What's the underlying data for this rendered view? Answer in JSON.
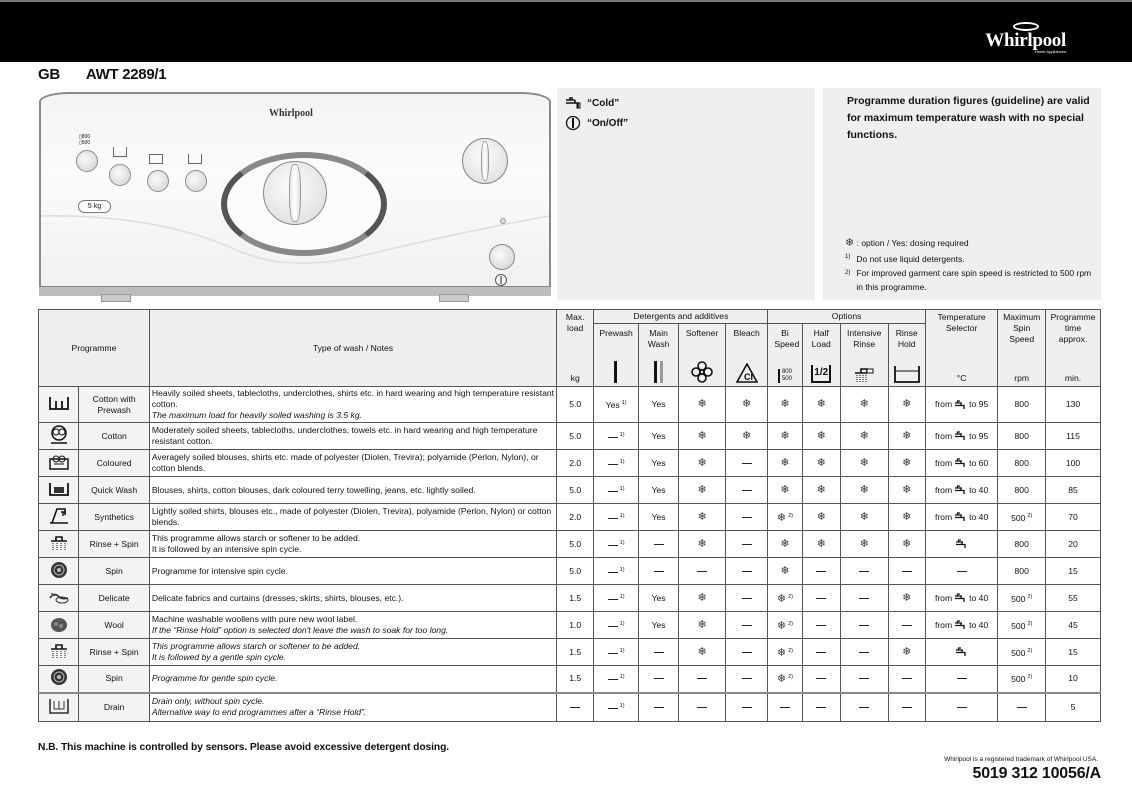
{
  "header": {
    "brand": "Whirlpool",
    "brand_sub": "Home Appliances",
    "country": "GB",
    "model": "AWT 2289/1"
  },
  "panel": {
    "brand": "Whirlpool",
    "load_badge": "5 kg"
  },
  "legend": {
    "cold_label": "“Cold”",
    "cold_icon": "cold-tap-icon",
    "onoff_label": "“On/Off”",
    "onoff_icon": "power-icon"
  },
  "info": {
    "lead": "Programme duration figures (guideline) are valid for maximum temperature wash with no special functions.",
    "option_note": ": option /  Yes: dosing required",
    "footnote1_mark": "1)",
    "footnote1": "Do not use liquid detergents.",
    "footnote2_mark": "2)",
    "footnote2": "For improved garment care spin speed is restricted to 500 rpm in this programme."
  },
  "table": {
    "headers": {
      "programme": "Programme",
      "type_of_wash": "Type of wash / Notes",
      "max_load": "Max. load",
      "max_load_unit": "kg",
      "detergents_group": "Detergents and additives",
      "prewash": "Prewash",
      "main_wash": "Main Wash",
      "softener": "Softener",
      "bleach": "Bleach",
      "options_group": "Options",
      "bi_speed": "Bi Speed",
      "bi_speed_icon_text_1": "800",
      "bi_speed_icon_text_2": "500",
      "half_load": "Half Load",
      "half_load_icon_text": "1/2",
      "intensive_rinse": "Intensive Rinse",
      "rinse_hold": "Rinse Hold",
      "temperature": "Temperature Selector",
      "temperature_unit": "°C",
      "spin": "Maximum Spin Speed",
      "spin_unit": "rpm",
      "time": "Programme time approx.",
      "time_unit": "min."
    },
    "rows": [
      {
        "icon": "cotton-prewash-icon",
        "name": "Cotton with Prewash",
        "desc": "Heavily soiled sheets, tablecloths, underclothes, shirts etc. in hard wearing and high temperature resistant cotton.",
        "note": "The maximum load for heavily soiled washing is 3.5 kg.",
        "load": "5.0",
        "prewash": "Yes",
        "prewash_fn": "1)",
        "main": "Yes",
        "softener": "option",
        "bleach": "option",
        "bispeed": "option",
        "bispeed_fn": "",
        "half": "option",
        "intensive": "option",
        "hold": "option",
        "temp_from": "from",
        "temp_to": "to 95",
        "temp_type": "range",
        "spin": "800",
        "spin_fn": "",
        "time": "130"
      },
      {
        "icon": "cotton-icon",
        "name": "Cotton",
        "desc": "Moderately soiled sheets, tablecloths, underclothes, towels etc. in hard wearing and high temperature resistant cotton.",
        "note": "",
        "load": "5.0",
        "prewash": "none",
        "prewash_fn": "1)",
        "main": "Yes",
        "softener": "option",
        "bleach": "option",
        "bispeed": "option",
        "bispeed_fn": "",
        "half": "option",
        "intensive": "option",
        "hold": "option",
        "temp_from": "from",
        "temp_to": "to 95",
        "temp_type": "range",
        "spin": "800",
        "spin_fn": "",
        "time": "115"
      },
      {
        "icon": "coloured-icon",
        "name": "Coloured",
        "desc": "Averagely soiled blouses, shirts etc. made of polyester (Diolen, Trevira); polyamide (Perlon, Nylon), or cotton blends.",
        "note": "",
        "load": "2.0",
        "prewash": "none",
        "prewash_fn": "1)",
        "main": "Yes",
        "softener": "option",
        "bleach": "none",
        "bispeed": "option",
        "bispeed_fn": "",
        "half": "option",
        "intensive": "option",
        "hold": "option",
        "temp_from": "from",
        "temp_to": "to 60",
        "temp_type": "range",
        "spin": "800",
        "spin_fn": "",
        "time": "100"
      },
      {
        "icon": "quick-wash-icon",
        "name": "Quick Wash",
        "desc": "Blouses, shirts, cotton blouses, dark coloured terry towelling, jeans, etc. lightly soiled.",
        "note": "",
        "load": "5.0",
        "prewash": "none",
        "prewash_fn": "1)",
        "main": "Yes",
        "softener": "option",
        "bleach": "none",
        "bispeed": "option",
        "bispeed_fn": "",
        "half": "option",
        "intensive": "option",
        "hold": "option",
        "temp_from": "from",
        "temp_to": "to 40",
        "temp_type": "range",
        "spin": "800",
        "spin_fn": "",
        "time": "85"
      },
      {
        "icon": "synthetics-icon",
        "name": "Synthetics",
        "desc": "Lightly soiled shirts, blouses etc., made of polyester (Diolen, Trevira), polyamide (Perlon, Nylon) or cotton blends.",
        "note": "",
        "load": "2.0",
        "prewash": "none",
        "prewash_fn": "1)",
        "main": "Yes",
        "softener": "option",
        "bleach": "none",
        "bispeed": "option",
        "bispeed_fn": "2)",
        "half": "option",
        "intensive": "option",
        "hold": "option",
        "temp_from": "from",
        "temp_to": "to 40",
        "temp_type": "range",
        "spin": "500",
        "spin_fn": "2)",
        "time": "70"
      },
      {
        "icon": "rinse-spin-icon",
        "name": "Rinse + Spin",
        "desc": "This programme allows starch or softener to be added.",
        "note": "It is followed by an intensive spin cycle.",
        "note_style": "normal",
        "load": "5.0",
        "prewash": "none",
        "prewash_fn": "1)",
        "main": "none",
        "softener": "option",
        "bleach": "none",
        "bispeed": "option",
        "bispeed_fn": "",
        "half": "option",
        "intensive": "option",
        "hold": "option",
        "temp_type": "cold",
        "spin": "800",
        "spin_fn": "",
        "time": "20"
      },
      {
        "icon": "spin-icon",
        "name": "Spin",
        "desc": "Programme for intensive spin cycle.",
        "note": "",
        "load": "5.0",
        "prewash": "none",
        "prewash_fn": "1)",
        "main": "none",
        "softener": "none",
        "bleach": "none",
        "bispeed": "option",
        "bispeed_fn": "",
        "half": "none",
        "intensive": "none",
        "hold": "none",
        "temp_type": "none",
        "spin": "800",
        "spin_fn": "",
        "time": "15"
      },
      {
        "icon": "delicate-icon",
        "name": "Delicate",
        "desc": "Delicate fabrics and curtains (dresses, skirts, shirts, blouses, etc.).",
        "note": "",
        "load": "1.5",
        "prewash": "none",
        "prewash_fn": "1)",
        "main": "Yes",
        "softener": "option",
        "bleach": "none",
        "bispeed": "option",
        "bispeed_fn": "2)",
        "half": "none",
        "intensive": "none",
        "hold": "option",
        "temp_from": "from",
        "temp_to": "to 40",
        "temp_type": "range",
        "spin": "500",
        "spin_fn": "2)",
        "time": "55"
      },
      {
        "icon": "wool-icon",
        "name": "Wool",
        "desc": "Machine washable woollens with pure new wool label.",
        "note": "If the “Rinse Hold” option is selected don't leave the wash to soak for too long.",
        "load": "1.0",
        "prewash": "none",
        "prewash_fn": "1)",
        "main": "Yes",
        "softener": "option",
        "bleach": "none",
        "bispeed": "option",
        "bispeed_fn": "2)",
        "half": "none",
        "intensive": "none",
        "hold": "none",
        "temp_from": "from",
        "temp_to": "to 40",
        "temp_type": "range",
        "spin": "500",
        "spin_fn": "2)",
        "time": "45"
      },
      {
        "icon": "rinse-spin-icon",
        "name": "Rinse + Spin",
        "desc": "",
        "note": "This programme allows starch or softener to be added.",
        "note2": "It is followed by a gentle spin cycle.",
        "load": "1.5",
        "prewash": "none",
        "prewash_fn": "1)",
        "main": "none",
        "softener": "option",
        "bleach": "none",
        "bispeed": "option",
        "bispeed_fn": "2)",
        "half": "none",
        "intensive": "none",
        "hold": "option",
        "temp_type": "cold",
        "spin": "500",
        "spin_fn": "2)",
        "time": "15"
      },
      {
        "icon": "spin-icon",
        "name": "Spin",
        "desc": "",
        "note": "Programme for gentle spin cycle.",
        "load": "1.5",
        "prewash": "none",
        "prewash_fn": "1)",
        "main": "none",
        "softener": "none",
        "bleach": "none",
        "bispeed": "option",
        "bispeed_fn": "2)",
        "half": "none",
        "intensive": "none",
        "hold": "none",
        "temp_type": "none",
        "spin": "500",
        "spin_fn": "2)",
        "time": "10"
      },
      {
        "icon": "drain-icon",
        "name": "Drain",
        "desc": "",
        "note": "Drain only, without spin cycle.",
        "note2": "Alternative way to end programmes after a “Rinse Hold”.",
        "load": "none",
        "prewash": "none",
        "prewash_fn": "1)",
        "main": "none",
        "softener": "none",
        "bleach": "none",
        "bispeed": "none",
        "bispeed_fn": "",
        "half": "none",
        "intensive": "none",
        "hold": "none",
        "temp_type": "none",
        "spin": "none",
        "spin_fn": "",
        "time": "5"
      }
    ]
  },
  "footer": {
    "nb": "N.B. This machine is controlled by sensors. Please avoid excessive detergent dosing.",
    "trademark": "Whirlpool is a registered trademark of Whirlpool USA.",
    "code": "5019 312 10056/A"
  }
}
